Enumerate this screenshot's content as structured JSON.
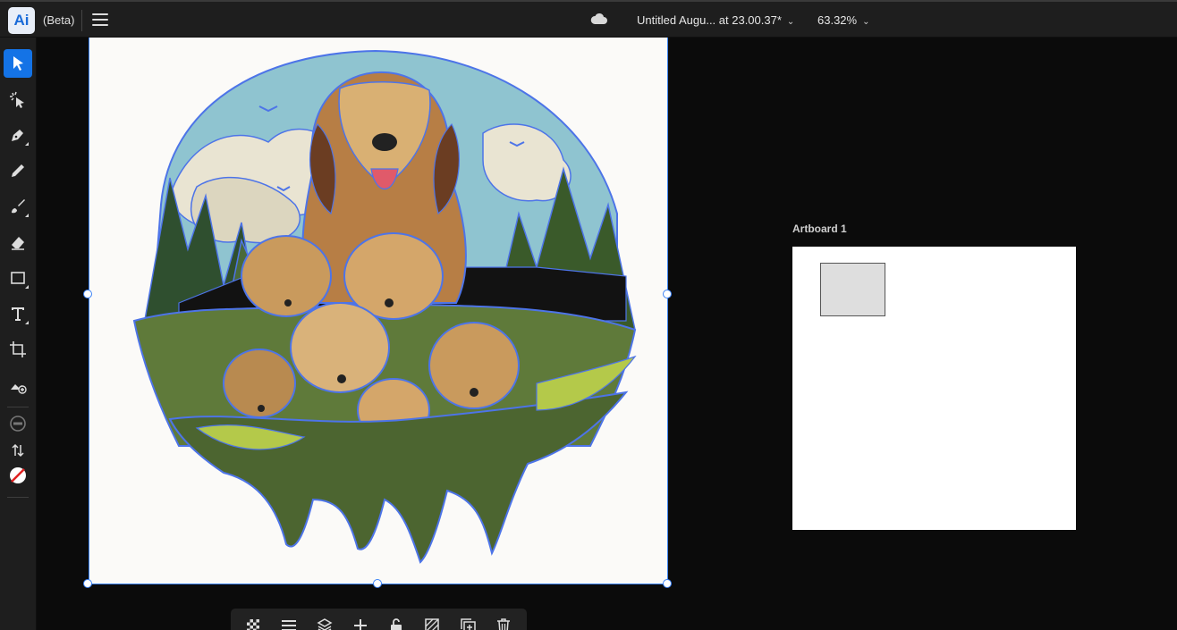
{
  "header": {
    "app_logo": "Ai",
    "beta_label": "(Beta)",
    "menu_icon": "hamburger-icon",
    "cloud_icon": "cloud-icon",
    "document_title": "Untitled Augu... at 23.00.37*",
    "zoom_level": "63.32%"
  },
  "tools": [
    {
      "name": "selection-tool",
      "icon": "arrow-icon",
      "active": true
    },
    {
      "name": "direct-selection-tool",
      "icon": "magic-select-icon"
    },
    {
      "name": "pen-tool",
      "icon": "pen-icon"
    },
    {
      "name": "pencil-tool",
      "icon": "pencil-icon"
    },
    {
      "name": "paintbrush-tool",
      "icon": "brush-icon"
    },
    {
      "name": "eraser-tool",
      "icon": "eraser-icon"
    },
    {
      "name": "rectangle-tool",
      "icon": "rectangle-icon"
    },
    {
      "name": "type-tool",
      "icon": "type-icon"
    },
    {
      "name": "artboard-tool",
      "icon": "crop-icon"
    },
    {
      "name": "add-image-tool",
      "icon": "image-add-icon"
    },
    {
      "name": "fill-stroke-none",
      "icon": "circle-minus-icon"
    },
    {
      "name": "swap-fill-stroke",
      "icon": "swap-arrows-icon"
    },
    {
      "name": "stroke-swatch",
      "icon": "no-color-icon"
    }
  ],
  "artboard": {
    "label": "Artboard 1"
  },
  "context_bar": [
    {
      "name": "transparency-icon"
    },
    {
      "name": "align-icon"
    },
    {
      "name": "arrange-icon"
    },
    {
      "name": "add-icon"
    },
    {
      "name": "lock-icon"
    },
    {
      "name": "mask-icon"
    },
    {
      "name": "duplicate-icon"
    },
    {
      "name": "delete-icon"
    }
  ],
  "colors": {
    "accent": "#1473e6",
    "selection": "#3b82f6",
    "background": "#0b0b0b",
    "panel": "#1e1e1e"
  }
}
